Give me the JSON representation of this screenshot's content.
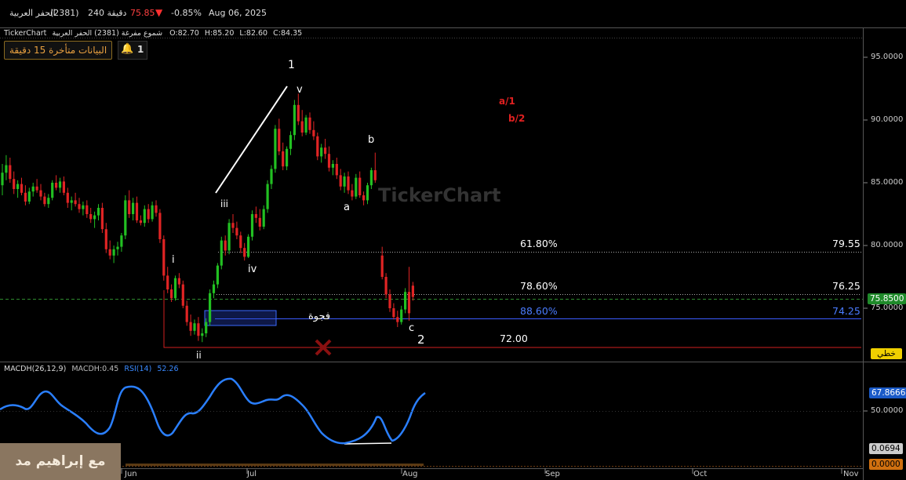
{
  "header": {
    "name": "الحفر العربية",
    "code": "(2381)",
    "interval": "240 دقيقة",
    "price": "75.85",
    "change_pct": "-0.85%",
    "date": "Aug 06, 2025"
  },
  "info_line": {
    "brand": "TickerChart",
    "desc": "شموع مفرغة (2381) الحفر العربية",
    "open": "O:82.70",
    "high": "H:85.20",
    "low": "L:82.60",
    "close": "C:84.35"
  },
  "delay_note": "البيانات متأخرة 15 دقيقة",
  "alert_count": "1",
  "watermark": "TickerChart",
  "price_axis": {
    "ticks": [
      "95.0000",
      "90.0000",
      "85.0000",
      "80.0000",
      "75.0000"
    ],
    "current": "75.8500",
    "mode_button": "خطي"
  },
  "wave_labels": {
    "w1": "1",
    "wi": "i",
    "wii": "ii",
    "wiii": "iii",
    "wiv": "iv",
    "wv": "v",
    "a": "a",
    "b": "b",
    "c": "c",
    "w2": "2",
    "a1": "a/1",
    "b2": "b/2"
  },
  "fib_levels": [
    {
      "pct": "61.80%",
      "value": "79.55",
      "color": "#ffffff"
    },
    {
      "pct": "78.60%",
      "value": "76.25",
      "color": "#ffffff"
    },
    {
      "pct": "88.60%",
      "value": "74.25",
      "color": "#4a7cff"
    },
    {
      "pct": "72.00",
      "value": "",
      "color": "#ffffff"
    }
  ],
  "gap_label": "فجوة",
  "indicator": {
    "macd_label": "MACDH(26,12,9)",
    "macd_value": "MACDH:0.45",
    "rsi_label": "RSI(14)",
    "rsi_value": "52.26",
    "axis_tick": "50.0000",
    "rsi_current": "67.8666",
    "macd_current1": "0.0694",
    "macd_current2": "0.0000"
  },
  "time_axis": [
    "Jun",
    "Jul",
    "Aug",
    "Sep",
    "Oct",
    "Nov"
  ],
  "user_watermark": "مع إبراهيم مد",
  "chart_data": {
    "type": "candlestick",
    "ylim": [
      71,
      97
    ],
    "candles": [
      [
        84.8,
        86.5,
        84.0,
        85.8
      ],
      [
        85.8,
        87.2,
        85.2,
        86.4
      ],
      [
        86.4,
        87.0,
        85.0,
        85.3
      ],
      [
        85.3,
        85.9,
        84.1,
        84.5
      ],
      [
        84.5,
        85.2,
        83.8,
        84.9
      ],
      [
        84.9,
        85.4,
        84.0,
        84.2
      ],
      [
        84.2,
        84.8,
        83.2,
        83.5
      ],
      [
        83.5,
        84.6,
        83.3,
        84.3
      ],
      [
        84.3,
        85.0,
        83.9,
        84.7
      ],
      [
        84.7,
        85.3,
        84.2,
        84.4
      ],
      [
        84.4,
        84.9,
        83.6,
        83.9
      ],
      [
        83.9,
        84.2,
        83.1,
        83.3
      ],
      [
        83.3,
        84.1,
        83.0,
        83.8
      ],
      [
        83.8,
        85.2,
        83.6,
        85.0
      ],
      [
        85.0,
        85.6,
        84.4,
        84.6
      ],
      [
        84.6,
        85.4,
        84.2,
        85.1
      ],
      [
        85.1,
        85.5,
        84.0,
        84.2
      ],
      [
        84.2,
        84.6,
        83.0,
        83.4
      ],
      [
        83.4,
        83.9,
        82.8,
        83.6
      ],
      [
        83.6,
        84.2,
        83.1,
        83.3
      ],
      [
        83.3,
        83.8,
        82.6,
        82.9
      ],
      [
        82.9,
        83.5,
        82.4,
        83.2
      ],
      [
        83.2,
        83.6,
        82.2,
        82.5
      ],
      [
        82.5,
        83.0,
        81.8,
        82.1
      ],
      [
        82.1,
        82.7,
        81.4,
        82.4
      ],
      [
        82.4,
        83.3,
        82.0,
        83.0
      ],
      [
        83.0,
        83.4,
        81.0,
        81.3
      ],
      [
        81.3,
        81.8,
        79.4,
        79.7
      ],
      [
        79.7,
        80.4,
        78.9,
        79.2
      ],
      [
        79.2,
        80.0,
        78.6,
        79.7
      ],
      [
        79.7,
        80.3,
        79.2,
        79.9
      ],
      [
        79.9,
        81.0,
        79.5,
        80.8
      ],
      [
        80.8,
        84.0,
        80.5,
        83.6
      ],
      [
        83.6,
        84.4,
        82.2,
        82.5
      ],
      [
        82.5,
        83.8,
        82.0,
        83.4
      ],
      [
        83.4,
        83.9,
        81.8,
        82.0
      ],
      [
        82.0,
        82.4,
        81.6,
        81.8
      ],
      [
        81.8,
        83.2,
        81.5,
        82.9
      ],
      [
        82.9,
        83.3,
        81.8,
        82.1
      ],
      [
        82.1,
        83.5,
        81.9,
        83.2
      ],
      [
        83.2,
        83.6,
        82.3,
        82.6
      ],
      [
        82.6,
        82.9,
        80.2,
        80.5
      ],
      [
        80.5,
        80.8,
        77.2,
        77.6
      ],
      [
        77.6,
        78.3,
        76.2,
        76.5
      ],
      [
        76.5,
        76.9,
        75.5,
        75.8
      ],
      [
        75.8,
        77.6,
        75.6,
        77.4
      ],
      [
        77.4,
        77.8,
        76.6,
        76.9
      ],
      [
        76.9,
        77.2,
        75.0,
        75.2
      ],
      [
        75.2,
        75.6,
        73.6,
        73.9
      ],
      [
        73.9,
        74.5,
        72.8,
        73.2
      ],
      [
        73.2,
        74.1,
        72.9,
        73.8
      ],
      [
        73.8,
        74.3,
        72.4,
        72.8
      ],
      [
        72.8,
        73.4,
        72.3,
        73.0
      ],
      [
        73.0,
        74.2,
        72.7,
        73.9
      ],
      [
        73.9,
        76.5,
        73.6,
        76.2
      ],
      [
        76.2,
        77.2,
        75.8,
        76.9
      ],
      [
        76.9,
        78.6,
        76.6,
        78.4
      ],
      [
        78.4,
        80.7,
        78.1,
        80.4
      ],
      [
        80.4,
        80.8,
        79.2,
        79.6
      ],
      [
        79.6,
        82.1,
        79.3,
        81.8
      ],
      [
        81.8,
        82.5,
        81.0,
        81.4
      ],
      [
        81.4,
        81.9,
        80.5,
        80.8
      ],
      [
        80.8,
        81.1,
        79.4,
        79.8
      ],
      [
        79.8,
        80.2,
        78.8,
        79.1
      ],
      [
        79.1,
        80.9,
        79.0,
        80.7
      ],
      [
        80.7,
        82.8,
        80.4,
        82.5
      ],
      [
        82.5,
        83.1,
        81.8,
        82.2
      ],
      [
        82.2,
        82.9,
        81.2,
        81.5
      ],
      [
        81.5,
        83.2,
        81.3,
        82.9
      ],
      [
        82.9,
        85.2,
        82.6,
        84.9
      ],
      [
        84.9,
        86.4,
        84.5,
        86.1
      ],
      [
        86.1,
        89.6,
        85.8,
        89.3
      ],
      [
        89.3,
        90.1,
        87.2,
        87.5
      ],
      [
        87.5,
        88.2,
        86.0,
        86.3
      ],
      [
        86.3,
        87.9,
        86.0,
        87.7
      ],
      [
        87.7,
        89.1,
        87.2,
        88.8
      ],
      [
        88.8,
        91.6,
        88.4,
        91.2
      ],
      [
        91.2,
        92.1,
        89.6,
        89.9
      ],
      [
        89.9,
        90.8,
        88.7,
        89.0
      ],
      [
        89.0,
        90.4,
        88.8,
        90.2
      ],
      [
        90.2,
        90.6,
        88.9,
        89.2
      ],
      [
        89.2,
        89.9,
        88.4,
        88.7
      ],
      [
        88.7,
        89.0,
        86.8,
        87.1
      ],
      [
        87.1,
        88.1,
        86.6,
        87.8
      ],
      [
        87.8,
        88.5,
        86.9,
        87.3
      ],
      [
        87.3,
        87.9,
        85.9,
        86.2
      ],
      [
        86.2,
        86.8,
        85.6,
        86.5
      ],
      [
        86.5,
        87.0,
        85.3,
        85.6
      ],
      [
        85.6,
        86.1,
        84.4,
        84.7
      ],
      [
        84.7,
        85.8,
        84.2,
        85.5
      ],
      [
        85.5,
        85.9,
        84.1,
        84.4
      ],
      [
        84.4,
        84.9,
        83.6,
        83.9
      ],
      [
        83.9,
        85.7,
        83.7,
        85.4
      ],
      [
        85.4,
        85.9,
        83.8,
        84.0
      ],
      [
        84.0,
        84.3,
        83.2,
        83.6
      ],
      [
        83.6,
        85.0,
        83.3,
        84.8
      ],
      [
        84.8,
        86.2,
        84.5,
        86.0
      ],
      [
        86.0,
        87.4,
        85.0,
        85.2
      ],
      [
        79.2,
        79.9,
        77.3,
        77.5
      ],
      [
        77.5,
        77.8,
        75.8,
        76.1
      ],
      [
        76.1,
        76.5,
        74.7,
        75.0
      ],
      [
        75.0,
        75.4,
        74.1,
        74.3
      ],
      [
        74.3,
        74.8,
        73.5,
        73.9
      ],
      [
        73.9,
        75.2,
        73.7,
        74.9
      ],
      [
        74.9,
        76.6,
        74.6,
        76.3
      ],
      [
        76.3,
        78.3,
        74.0,
        74.6
      ],
      [
        76.8,
        77.1,
        75.6,
        75.9
      ]
    ]
  }
}
